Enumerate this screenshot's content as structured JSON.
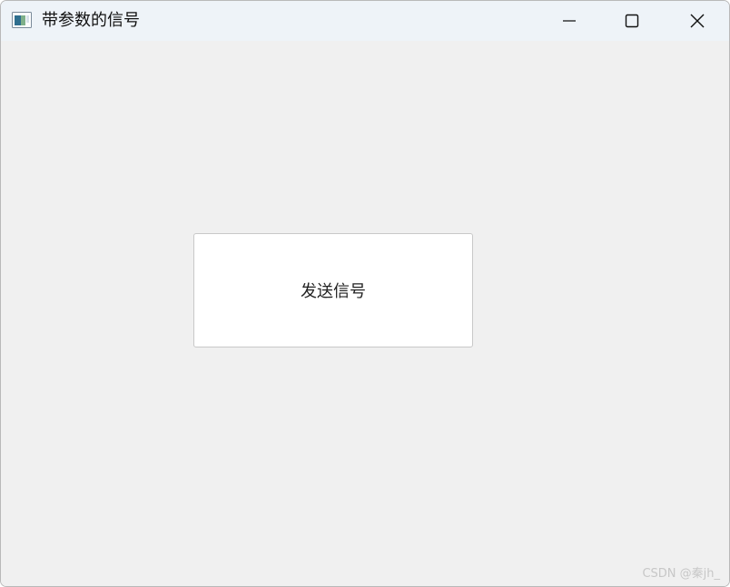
{
  "window": {
    "title": "带参数的信号",
    "icons": {
      "app": "app-window-icon",
      "minimize": "minimize-icon",
      "maximize": "maximize-icon",
      "close": "close-icon"
    }
  },
  "main": {
    "send_button_label": "发送信号"
  },
  "watermark": "CSDN @秦jh_",
  "colors": {
    "titlebar": "#eef3f8",
    "client": "#f0f0f0",
    "button_bg": "#ffffff",
    "button_border": "#c8c8c8"
  }
}
